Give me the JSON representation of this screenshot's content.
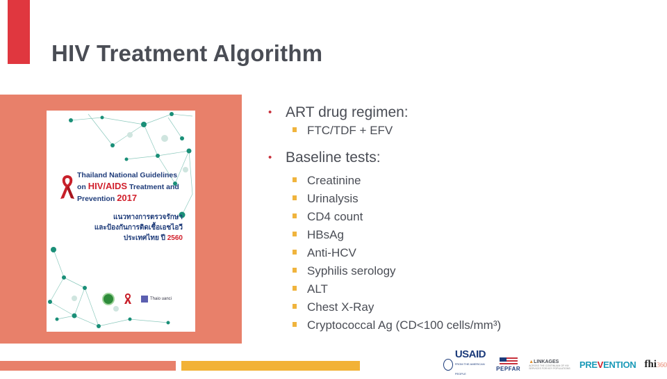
{
  "slide": {
    "title": "HIV Treatment Algorithm",
    "colors": {
      "title_accent": "#e0373f",
      "panel": "#e8806a",
      "bullet_level1": "#c8313c",
      "bullet_level2": "#f0b43d",
      "footer_bar_1": "#e8806a",
      "footer_bar_2": "#f2b236",
      "text": "#4a4d55"
    }
  },
  "cover": {
    "line1": "Thailand National Guidelines",
    "line2_pre": "on ",
    "line2_red": "HIV/AIDS",
    "line2_post": " Treatment and",
    "line3_pre": "Prevention ",
    "line3_red": "2017",
    "thai_line1": "แนวทางการตรวจรักษา",
    "thai_line2": "และป้องกันการติดเชื้อเอชไอวี",
    "thai_line3_pre": "ประเทศไทย ปี ",
    "thai_line3_red": "2560",
    "logo_tc": "Thaio uanci",
    "icon": "red-ribbon-icon"
  },
  "content": {
    "sections": [
      {
        "heading": "ART drug regimen:",
        "items": [
          "FTC/TDF + EFV"
        ]
      },
      {
        "heading": "Baseline tests:",
        "items": [
          "Creatinine",
          "Urinalysis",
          "CD4 count",
          "HBsAg",
          "Anti-HCV",
          "Syphilis serology",
          "ALT",
          "Chest X-Ray",
          "Cryptococcal Ag (CD<100 cells/mm³)"
        ]
      }
    ]
  },
  "footer": {
    "logos": {
      "usaid": "USAID",
      "usaid_sub": "FROM THE AMERICAN PEOPLE",
      "pepfar": "PEPFAR",
      "linkages": "LINKAGES",
      "linkages_sub": "ACROSS THE CONTINUUM OF HIV SERVICES FOR KEY POPULATIONS",
      "prevention_pre": "PRE",
      "prevention_v": "V",
      "prevention_post": "ENTION",
      "fhi": "fhi",
      "fhi_num": "360"
    }
  }
}
